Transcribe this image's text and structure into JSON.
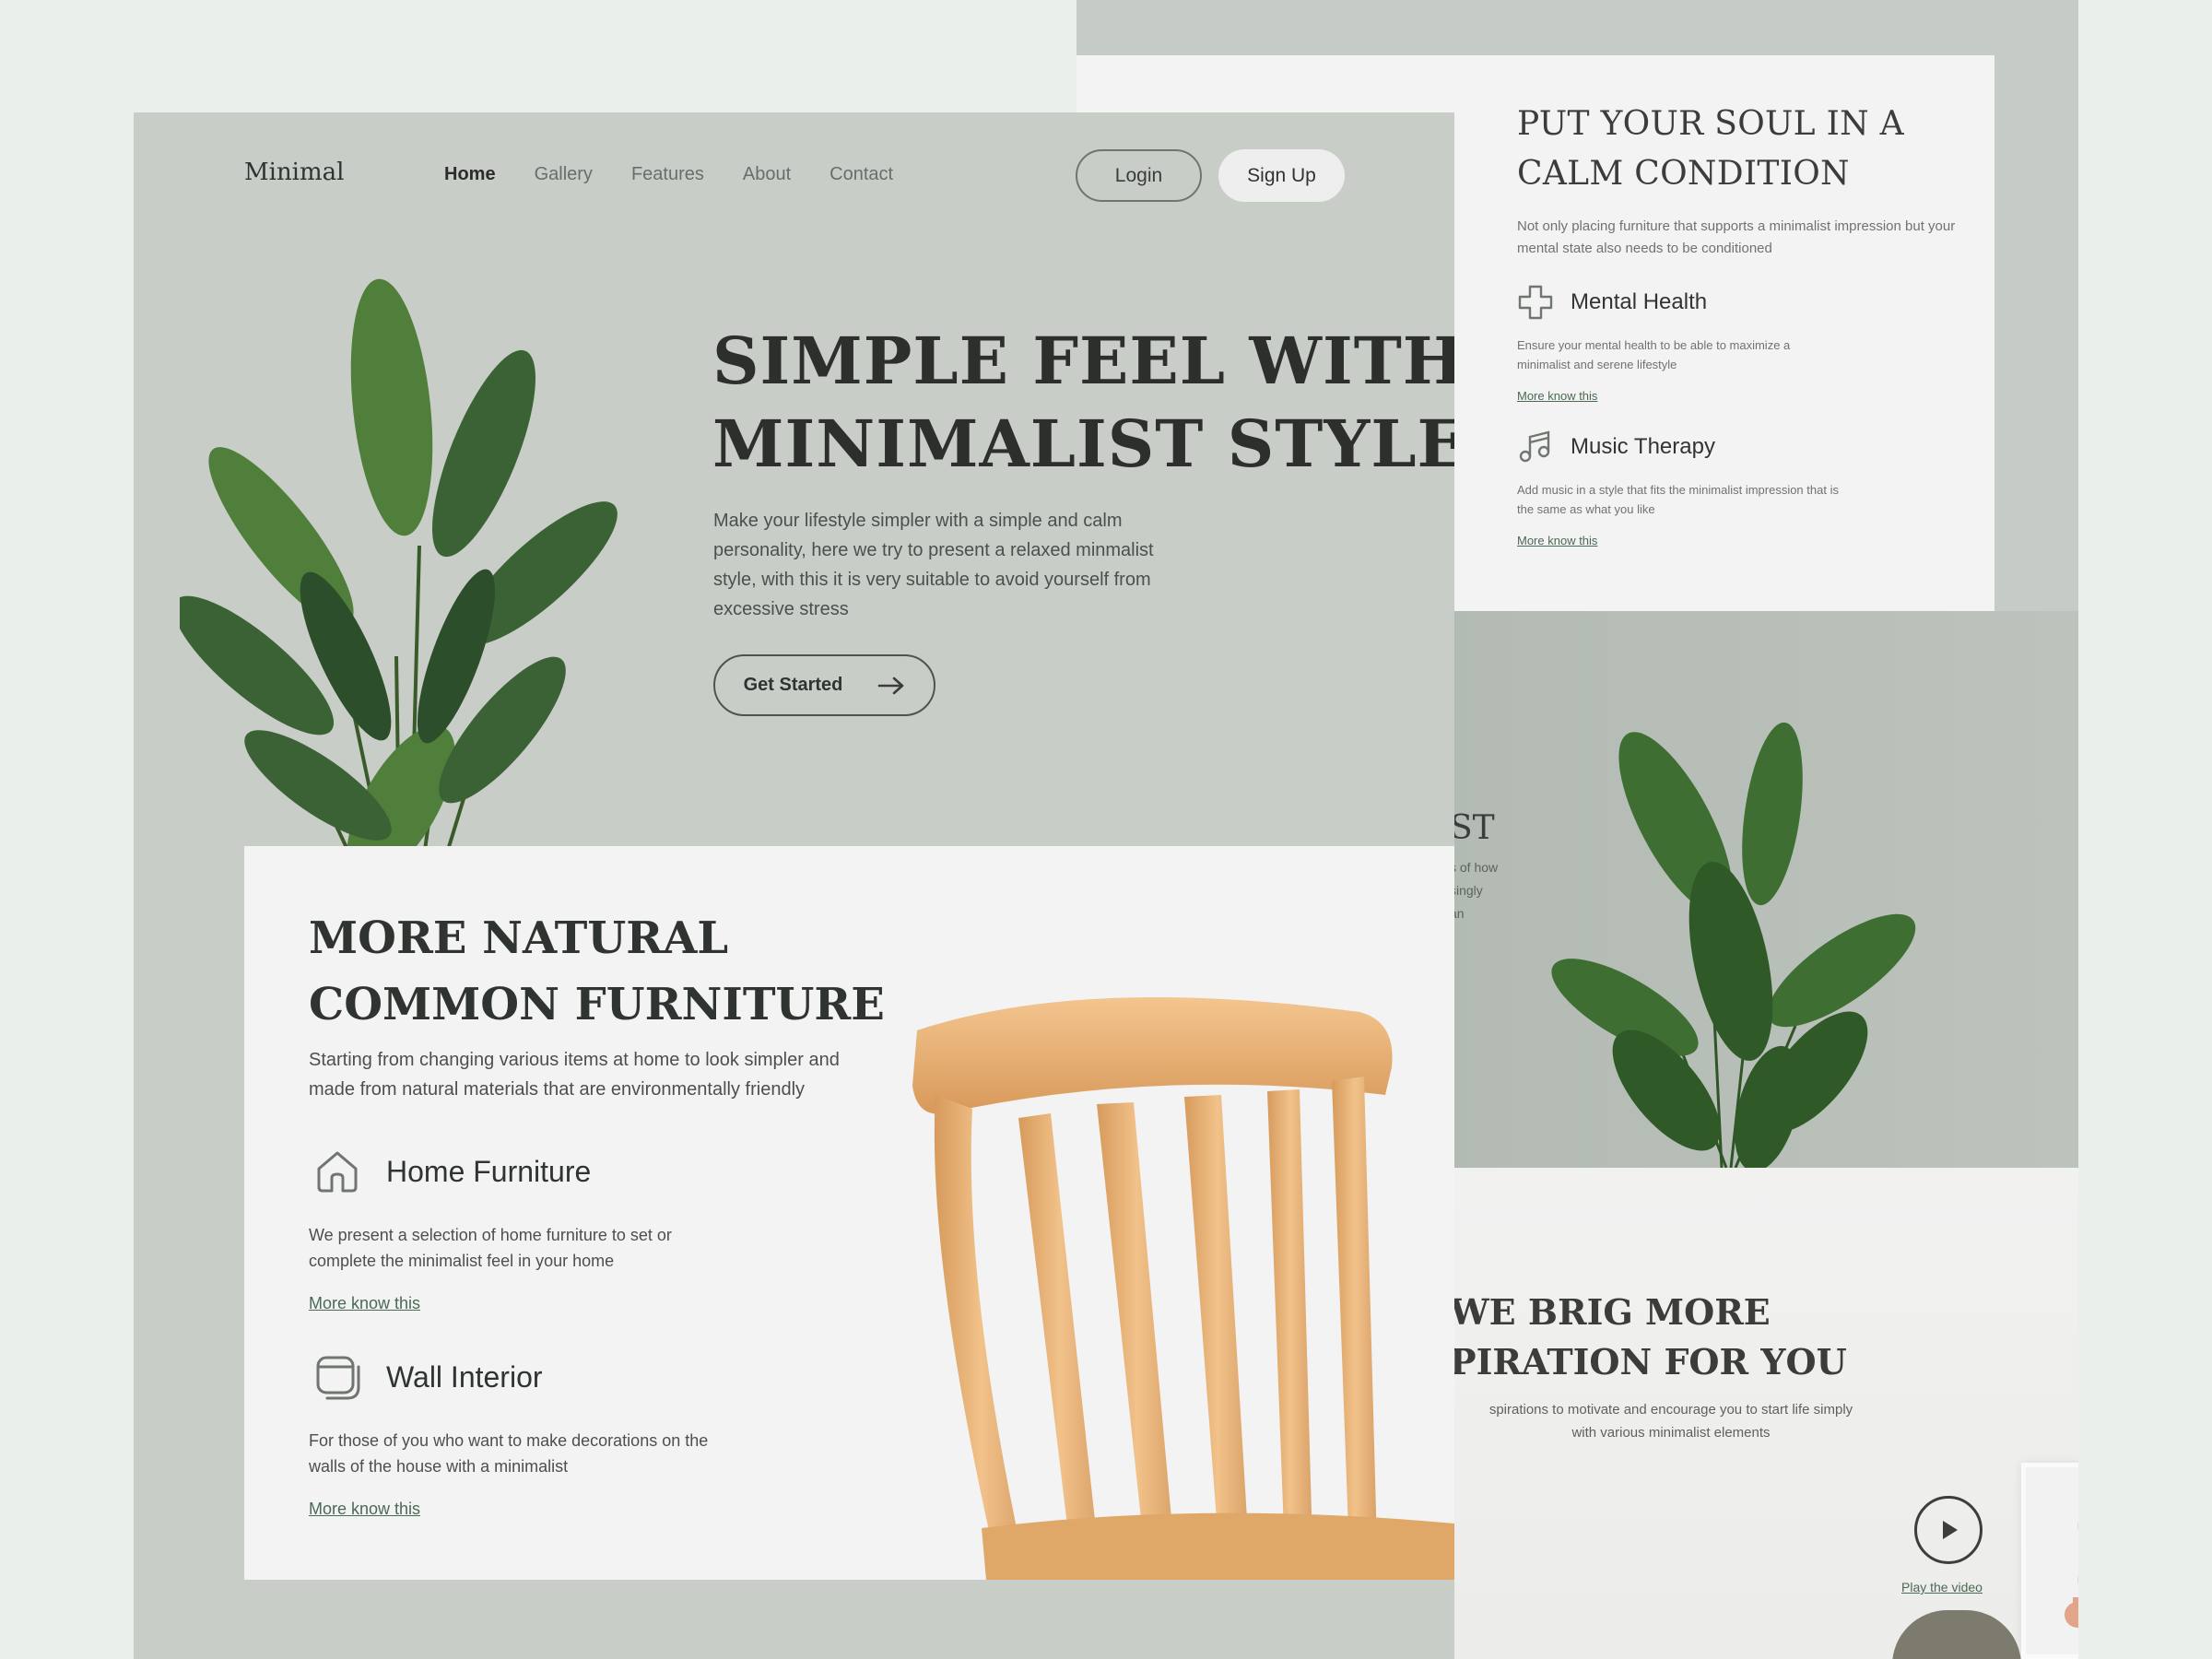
{
  "brand": {
    "logo": "Minimal"
  },
  "nav": {
    "items": [
      {
        "label": "Home",
        "active": true
      },
      {
        "label": "Gallery",
        "active": false
      },
      {
        "label": "Features",
        "active": false
      },
      {
        "label": "About",
        "active": false
      },
      {
        "label": "Contact",
        "active": false
      }
    ],
    "login": "Login",
    "signup": "Sign Up"
  },
  "hero": {
    "title_line1": "SIMPLE FEEL WITH",
    "title_line2": "MINIMALIST STYLE",
    "description": "Make your lifestyle simpler with a simple and calm personality, here we try to present a relaxed minmalist style, with this it is very suitable to avoid yourself from excessive stress",
    "cta": "Get Started"
  },
  "furniture": {
    "title_line1": "MORE NATURAL",
    "title_line2": "COMMON FURNITURE",
    "description": "Starting from changing various items at home to look simpler and made from natural materials that are environmentally friendly",
    "features": [
      {
        "icon": "home-icon",
        "title": "Home Furniture",
        "description": "We present a selection of home furniture to set or complete the minimalist feel in your home",
        "link": "More know this"
      },
      {
        "icon": "wall-frame-icon",
        "title": "Wall Interior",
        "description": "For those of you who want to make decorations on the walls of the house with a minimalist",
        "link": "More know this"
      }
    ]
  },
  "soul": {
    "title_line1": "PUT YOUR SOUL IN A",
    "title_line2": "CALM CONDITION",
    "description": "Not only placing furniture that supports a minimalist impression but your mental state also needs to be conditioned",
    "features": [
      {
        "icon": "plus-cross-icon",
        "title": "Mental Health",
        "description": "Ensure your mental health to be able to maximize a minimalist and serene lifestyle",
        "link": "More know this"
      },
      {
        "icon": "music-note-icon",
        "title": "Music Therapy",
        "description": "Add music in a style that fits the minimalist impression that is the same as what you like",
        "link": "More know this"
      }
    ]
  },
  "partial_section": {
    "title_fragment": "ST",
    "lines": [
      "s of how",
      "singly",
      "an"
    ]
  },
  "inspiration": {
    "title_line1": "WE BRIG MORE",
    "title_line2": "PIRATION FOR YOU",
    "description_line1": "spirations to motivate and encourage you to start life simply",
    "description_line2": "with various minimalist elements",
    "play_label": "Play the video"
  },
  "colors": {
    "page_bg": "#eaefeb",
    "sage": "#c9cdc8",
    "card": "#f3f3f3",
    "link_green": "#4b6a55",
    "text_dark": "#2f3430"
  }
}
